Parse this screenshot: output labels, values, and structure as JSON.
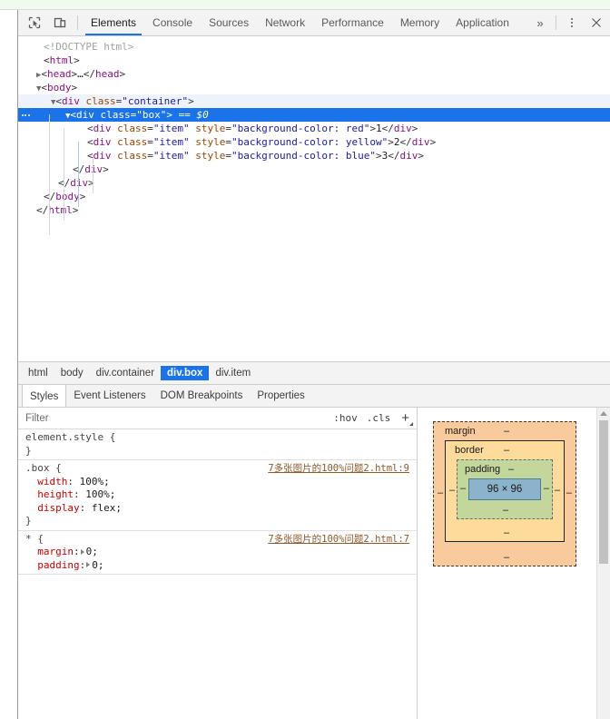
{
  "toolbar": {
    "icons": [
      {
        "name": "inspect-element-icon",
        "label": "Inspect element"
      },
      {
        "name": "device-toolbar-icon",
        "label": "Toggle device toolbar"
      }
    ],
    "tabs": [
      {
        "label": "Elements",
        "active": true
      },
      {
        "label": "Console",
        "active": false
      },
      {
        "label": "Sources",
        "active": false
      },
      {
        "label": "Network",
        "active": false
      },
      {
        "label": "Performance",
        "active": false
      },
      {
        "label": "Memory",
        "active": false
      },
      {
        "label": "Application",
        "active": false
      }
    ],
    "more_tabs_label": "»",
    "menu_label": "Customize and control DevTools",
    "close_label": "✕",
    "active_tab_color": "#1a73e8"
  },
  "dom": {
    "lines": [
      {
        "indent": 0,
        "twisty": "",
        "html": "<span class=\"doctype\">&lt;!DOCTYPE html&gt;</span>"
      },
      {
        "indent": 0,
        "twisty": "",
        "html": "<span class=\"punct\">&lt;</span><span class=\"tag\">html</span><span class=\"punct\">&gt;</span>"
      },
      {
        "indent": 0,
        "twisty": "▶",
        "html": "<span class=\"punct\">&lt;</span><span class=\"tag\">head</span><span class=\"punct\">&gt;</span><span class=\"txt\">…</span><span class=\"punct\">&lt;/</span><span class=\"tag\">head</span><span class=\"punct\">&gt;</span>"
      },
      {
        "indent": 0,
        "twisty": "▼",
        "html": "<span class=\"punct\">&lt;</span><span class=\"tag\">body</span><span class=\"punct\">&gt;</span>"
      },
      {
        "indent": 1,
        "twisty": "▼",
        "html": "<span class=\"punct\">&lt;</span><span class=\"tag\">div</span> <span class=\"attr\">class</span><span class=\"punct\">=</span><span class=\"val\">\"container\"</span><span class=\"punct\">&gt;</span>",
        "state": "sel-parent"
      },
      {
        "indent": 2,
        "twisty": "▼",
        "html": "<span class=\"punct\">&lt;</span><span class=\"tag\">div</span> <span class=\"attr\">class</span><span class=\"punct\">=</span><span class=\"val\">\"box\"</span><span class=\"punct\">&gt;</span> <span class=\"txt\">==</span> <span class=\"dollar\">$0</span>",
        "state": "selected",
        "badge": true
      },
      {
        "indent": 3,
        "twisty": "",
        "html": "<span class=\"punct\">&lt;</span><span class=\"tag\">div</span> <span class=\"attr\">class</span><span class=\"punct\">=</span><span class=\"val\">\"item\"</span> <span class=\"attr\">style</span><span class=\"punct\">=</span><span class=\"val\">\"background-color: red\"</span><span class=\"punct\">&gt;</span><span class=\"txt\">1</span><span class=\"punct\">&lt;/</span><span class=\"tag\">div</span><span class=\"punct\">&gt;</span>"
      },
      {
        "indent": 3,
        "twisty": "",
        "html": "<span class=\"punct\">&lt;</span><span class=\"tag\">div</span> <span class=\"attr\">class</span><span class=\"punct\">=</span><span class=\"val\">\"item\"</span> <span class=\"attr\">style</span><span class=\"punct\">=</span><span class=\"val\">\"background-color: yellow\"</span><span class=\"punct\">&gt;</span><span class=\"txt\">2</span><span class=\"punct\">&lt;/</span><span class=\"tag\">div</span><span class=\"punct\">&gt;</span>"
      },
      {
        "indent": 3,
        "twisty": "",
        "html": "<span class=\"punct\">&lt;</span><span class=\"tag\">div</span> <span class=\"attr\">class</span><span class=\"punct\">=</span><span class=\"val\">\"item\"</span> <span class=\"attr\">style</span><span class=\"punct\">=</span><span class=\"val\">\"background-color: blue\"</span><span class=\"punct\">&gt;</span><span class=\"txt\">3</span><span class=\"punct\">&lt;/</span><span class=\"tag\">div</span><span class=\"punct\">&gt;</span>"
      },
      {
        "indent": 2,
        "twisty": "",
        "html": "<span class=\"punct\">&lt;/</span><span class=\"tag\">div</span><span class=\"punct\">&gt;</span>"
      },
      {
        "indent": 1,
        "twisty": "",
        "html": "<span class=\"punct\">&lt;/</span><span class=\"tag\">div</span><span class=\"punct\">&gt;</span>"
      },
      {
        "indent": 0,
        "twisty": "",
        "html": "<span class=\"punct\">&lt;/</span><span class=\"tag\">body</span><span class=\"punct\">&gt;</span>"
      },
      {
        "indent": -1,
        "twisty": "",
        "html": "<span class=\"punct\">&lt;/</span><span class=\"tag\">html</span><span class=\"punct\">&gt;</span>"
      }
    ],
    "selected_node": "div.box",
    "selection_color": "#1a73e8"
  },
  "breadcrumb": {
    "items": [
      {
        "label": "html",
        "active": false
      },
      {
        "label": "body",
        "active": false
      },
      {
        "label": "div.container",
        "active": false
      },
      {
        "label": "div.box",
        "active": true
      },
      {
        "label": "div.item",
        "active": false
      }
    ]
  },
  "sidebar_tabs": [
    {
      "label": "Styles",
      "active": true
    },
    {
      "label": "Event Listeners",
      "active": false
    },
    {
      "label": "DOM Breakpoints",
      "active": false
    },
    {
      "label": "Properties",
      "active": false
    }
  ],
  "styles": {
    "filter_placeholder": "Filter",
    "hov_label": ":hov",
    "cls_label": ".cls",
    "new_rule_label": "+",
    "rules": [
      {
        "selector": "element.style {",
        "close": "}",
        "source": "",
        "greyed": true,
        "declarations": []
      },
      {
        "selector": ".box {",
        "close": "}",
        "source": "7多张图片的100%问题2.html:9",
        "greyed": false,
        "declarations": [
          {
            "prop": "width",
            "value": "100%;",
            "expandable": false
          },
          {
            "prop": "height",
            "value": "100%;",
            "expandable": false
          },
          {
            "prop": "display",
            "value": "flex;",
            "expandable": false
          }
        ]
      },
      {
        "selector": "* {",
        "close": "",
        "source": "7多张图片的100%问题2.html:7",
        "greyed": false,
        "declarations": [
          {
            "prop": "margin",
            "value": "0;",
            "expandable": true
          },
          {
            "prop": "padding",
            "value": "0;",
            "expandable": true
          }
        ]
      }
    ]
  },
  "box_model": {
    "margin_label": "margin",
    "border_label": "border",
    "padding_label": "padding",
    "content_size": "96 × 96",
    "margin_value": "–",
    "border_value": "–",
    "padding_value": "–",
    "dash": "–",
    "colors": {
      "margin": "#f9cb9c",
      "border": "#fddc9b",
      "padding": "#c3d69b",
      "content": "#8cb3cc"
    }
  }
}
